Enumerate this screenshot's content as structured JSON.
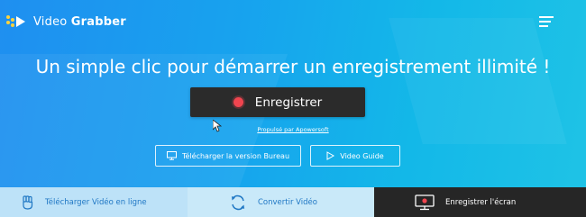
{
  "brand": {
    "name_light": "Video ",
    "name_bold": "Grabber"
  },
  "hero": {
    "headline": "Un simple clic pour démarrer un enregistrement illimité !",
    "record_label": "Enregistrer",
    "powered_by": "Propulsé par Apowersoft"
  },
  "actions": {
    "desktop_label": "Télécharger la version Bureau",
    "guide_label": "Video Guide"
  },
  "bottom_nav": [
    {
      "label": "Télécharger Vidéo en ligne",
      "icon": "fist-icon"
    },
    {
      "label": "Convertir Vidéo",
      "icon": "convert-icon"
    },
    {
      "label": "Enregistrer l'écran",
      "icon": "screen-record-icon",
      "active": true
    }
  ],
  "colors": {
    "accent_blue": "#1f8ff0",
    "record_red": "#f0454f",
    "dark": "#262626",
    "link_blue": "#1f77c4"
  }
}
